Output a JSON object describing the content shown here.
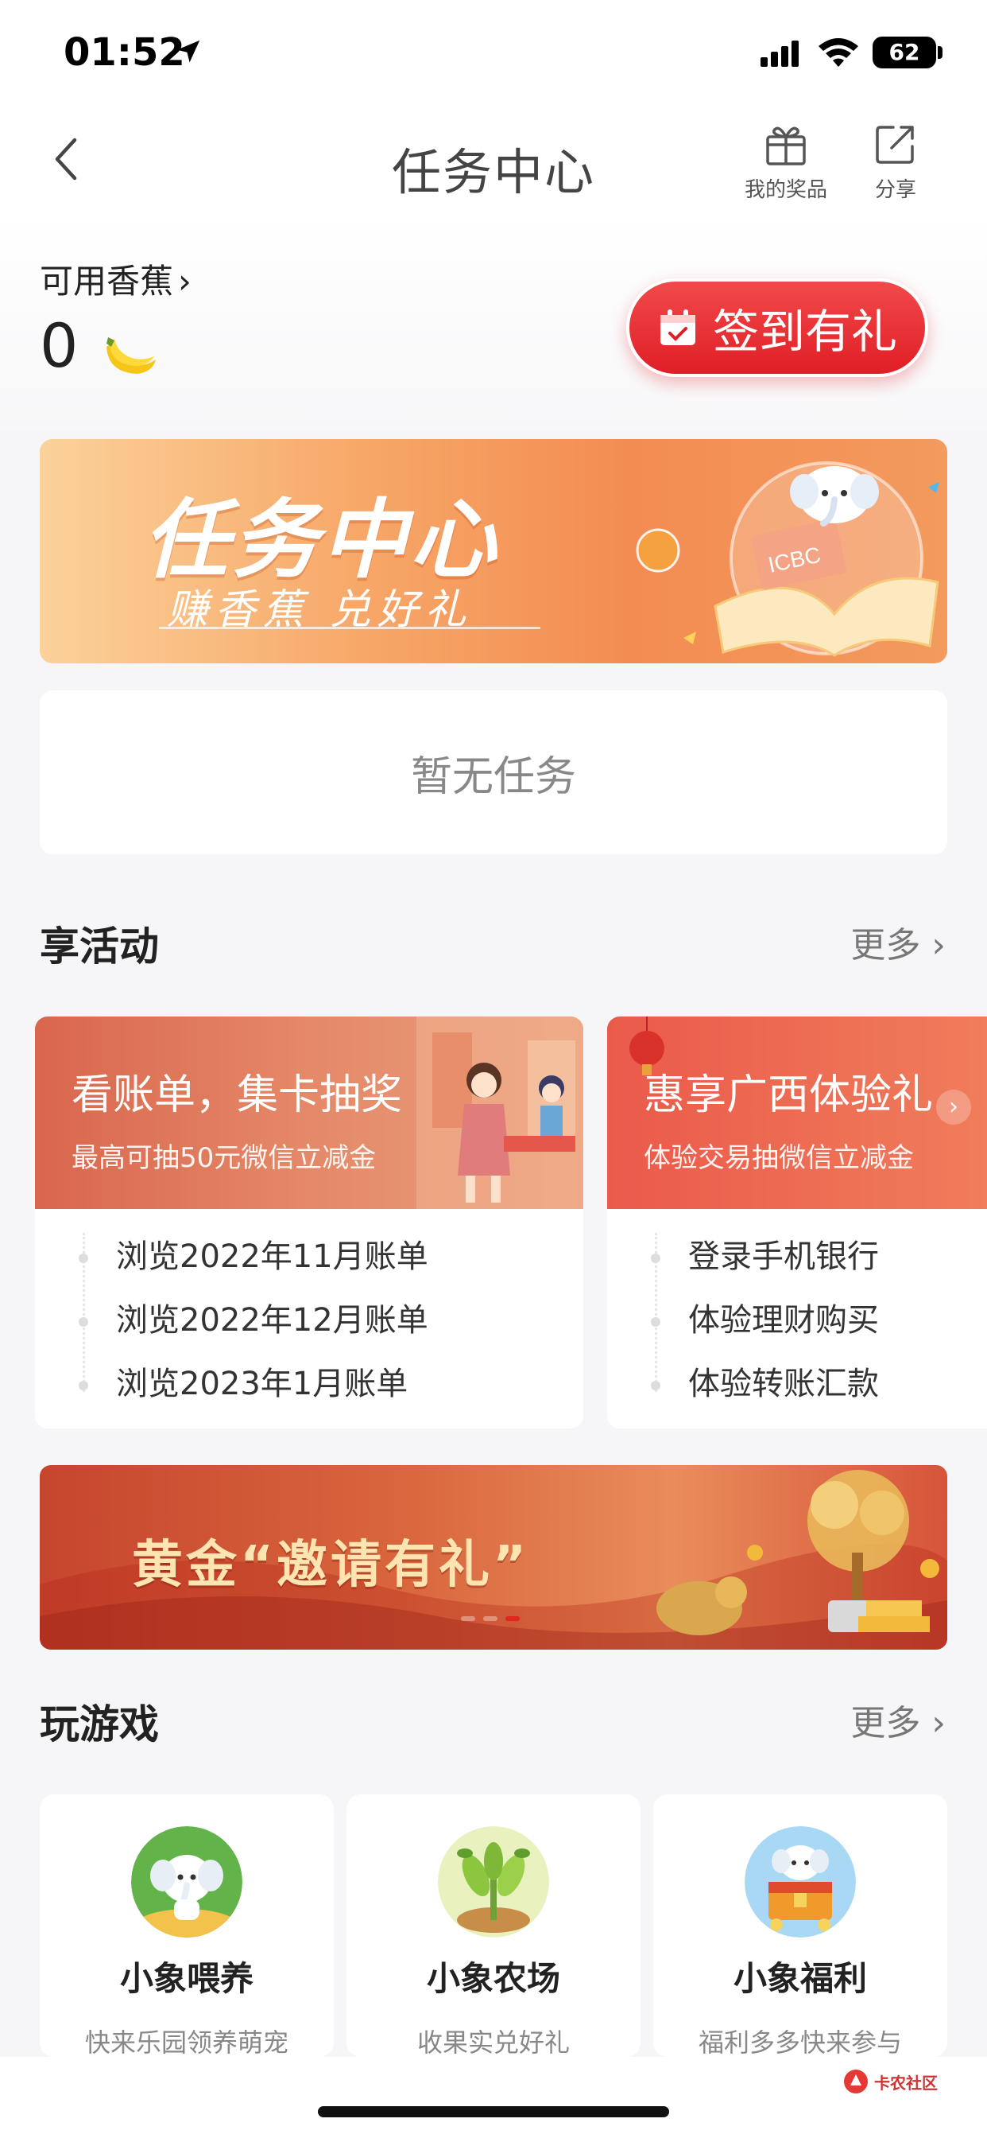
{
  "status_bar": {
    "time": "01:52",
    "battery": "62"
  },
  "header": {
    "title": "任务中心",
    "prizes_label": "我的奖品",
    "share_label": "分享"
  },
  "bananas": {
    "label": "可用香蕉",
    "count": "0"
  },
  "signin": {
    "label": "签到有礼"
  },
  "hero": {
    "title": "任务中心",
    "subtitle": "赚香蕉 兑好礼",
    "badge": "ICBC"
  },
  "tasks": {
    "empty_text": "暂无任务"
  },
  "activities": {
    "title": "享活动",
    "more": "更多",
    "cards": [
      {
        "title": "看账单，集卡抽奖",
        "subtitle": "最高可抽50元微信立减金",
        "items": [
          "浏览2022年11月账单",
          "浏览2022年12月账单",
          "浏览2023年1月账单"
        ]
      },
      {
        "title": "惠享广西体验礼",
        "subtitle": "体验交易抽微信立减金",
        "items": [
          "登录手机银行",
          "体验理财购买",
          "体验转账汇款"
        ]
      }
    ]
  },
  "gold_banner": {
    "text": "黄金“邀请有礼”"
  },
  "games": {
    "title": "玩游戏",
    "more": "更多",
    "cards": [
      {
        "name": "小象喂养",
        "desc": "快来乐园领养萌宠"
      },
      {
        "name": "小象农场",
        "desc": "收果实兑好礼"
      },
      {
        "name": "小象福利",
        "desc": "福利多多快来参与"
      }
    ]
  },
  "watermark": {
    "text": "卡农社区"
  },
  "colors": {
    "accent": "#e01e26",
    "hero_orange": "#f38c52"
  }
}
